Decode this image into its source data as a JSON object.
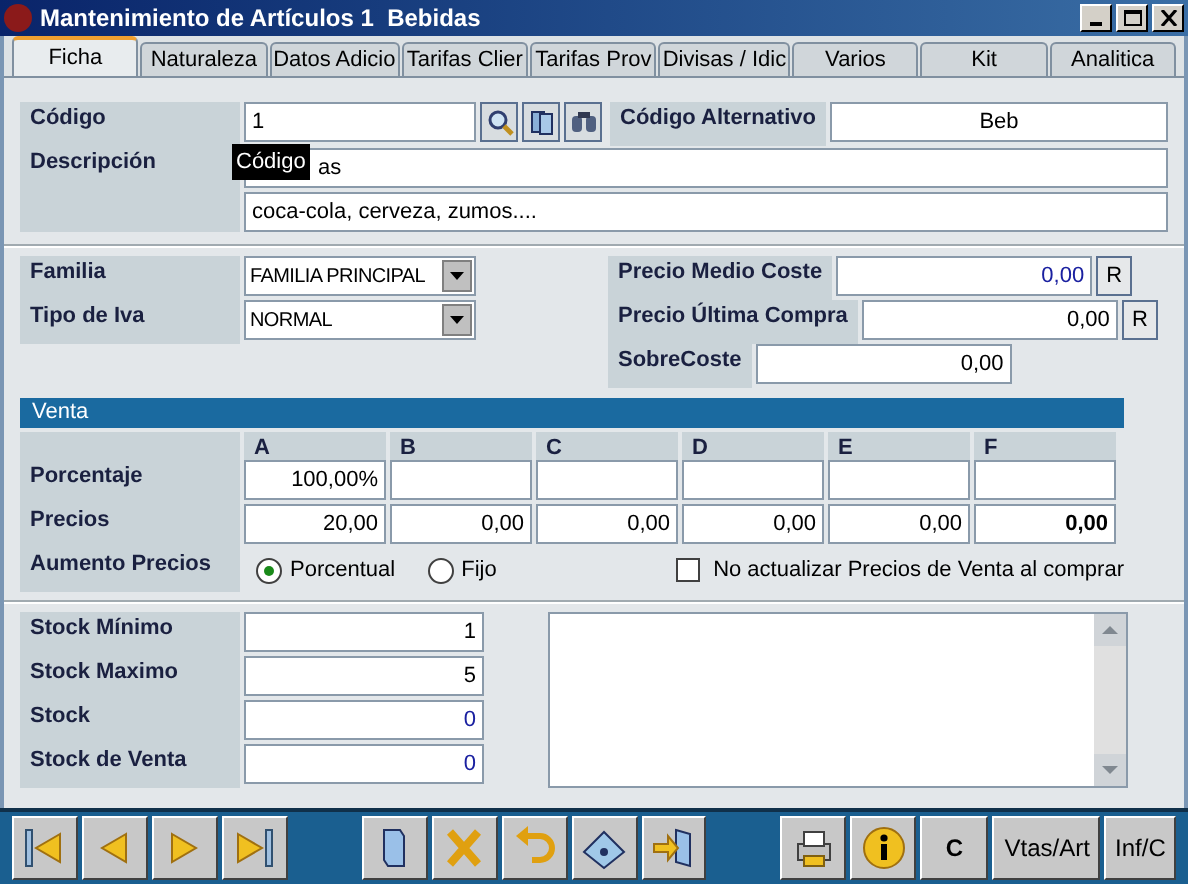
{
  "window": {
    "title": "Mantenimiento de Artículos 1  Bebidas"
  },
  "tabs": [
    {
      "label": "Ficha",
      "selected": true
    },
    {
      "label": "Naturaleza",
      "selected": false
    },
    {
      "label": "Datos Adicio",
      "selected": false
    },
    {
      "label": "Tarifas Clier",
      "selected": false
    },
    {
      "label": "Tarifas Prov",
      "selected": false
    },
    {
      "label": "Divisas / Idic",
      "selected": false
    },
    {
      "label": "Varios",
      "selected": false
    },
    {
      "label": "Kit",
      "selected": false
    },
    {
      "label": "Analitica",
      "selected": false
    }
  ],
  "codigo": {
    "label": "Código",
    "value": "1",
    "tooltip": "Código"
  },
  "codigo_alternativo": {
    "label": "Código Alternativo",
    "value": "Beb"
  },
  "descripcion": {
    "label": "Descripción",
    "value": "as",
    "value_2": "coca-cola, cerveza, zumos...."
  },
  "familia": {
    "label": "Familia",
    "value": "FAMILIA PRINCIPAL"
  },
  "tipo_iva": {
    "label": "Tipo de Iva",
    "value": "NORMAL"
  },
  "costes": [
    {
      "label": "Precio Medio Coste",
      "value": "0,00",
      "button": "R",
      "computed": true
    },
    {
      "label": "Precio Última Compra",
      "value": "0,00",
      "button": "R",
      "computed": false
    },
    {
      "label": "SobreCoste",
      "value": "0,00",
      "computed": false
    }
  ],
  "venta": {
    "title": "Venta",
    "columns": [
      "A",
      "B",
      "C",
      "D",
      "E",
      "F"
    ],
    "rows": [
      {
        "label": "Porcentaje",
        "cells": [
          "100,00%",
          "",
          "",
          "",
          "",
          ""
        ]
      },
      {
        "label": "Precios",
        "cells": [
          "20,00",
          "0,00",
          "0,00",
          "0,00",
          "0,00",
          "0,00"
        ],
        "bold_last": true
      }
    ],
    "aumento": {
      "label": "Aumento Precios",
      "options": [
        {
          "label": "Porcentual",
          "selected": true
        },
        {
          "label": "Fijo",
          "selected": false
        }
      ]
    },
    "no_actualizar": {
      "label": "No actualizar Precios de Venta al comprar",
      "checked": false
    }
  },
  "stock": [
    {
      "label": "Stock Mínimo",
      "value": "1",
      "computed": false
    },
    {
      "label": "Stock Maximo",
      "value": "5",
      "computed": false
    },
    {
      "label": "Stock",
      "value": "0",
      "computed": true
    },
    {
      "label": "Stock de Venta",
      "value": "0",
      "computed": true
    }
  ],
  "toolbar": [
    {
      "kind": "first"
    },
    {
      "kind": "prev"
    },
    {
      "kind": "next"
    },
    {
      "kind": "last"
    },
    {
      "kind": "gap"
    },
    {
      "kind": "new"
    },
    {
      "kind": "delete"
    },
    {
      "kind": "undo"
    },
    {
      "kind": "save"
    },
    {
      "kind": "exit"
    },
    {
      "kind": "gap"
    },
    {
      "kind": "print"
    },
    {
      "kind": "info"
    },
    {
      "kind": "text",
      "label": "C"
    },
    {
      "kind": "text",
      "label": "Vtas/Art"
    },
    {
      "kind": "text",
      "label": "Inf/C"
    }
  ]
}
